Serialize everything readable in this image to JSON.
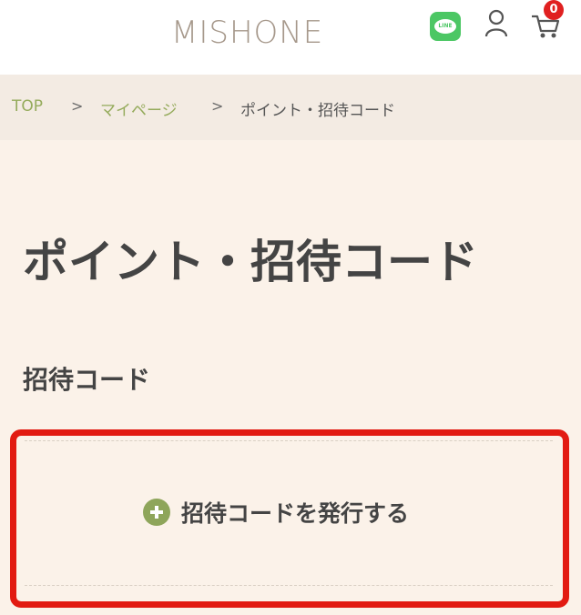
{
  "header": {
    "logo_text": "MISHONE",
    "line_icon_text": "LINE",
    "cart_count": "0"
  },
  "breadcrumb": {
    "items": [
      "TOP",
      "マイページ",
      "ポイント・招待コード"
    ],
    "separator": ">"
  },
  "main": {
    "page_title": "ポイント・招待コード",
    "section_heading": "招待コード",
    "issue_button_label": "招待コードを発行する"
  },
  "colors": {
    "page_background": "#fbf2e9",
    "breadcrumb_background": "#f3ebe3",
    "link_green": "#95ab5c",
    "highlight_red": "#e21b12",
    "badge_red": "#e02020",
    "line_green": "#4cc764"
  },
  "icons": [
    "line-icon",
    "user-icon",
    "cart-icon",
    "plus-icon"
  ]
}
